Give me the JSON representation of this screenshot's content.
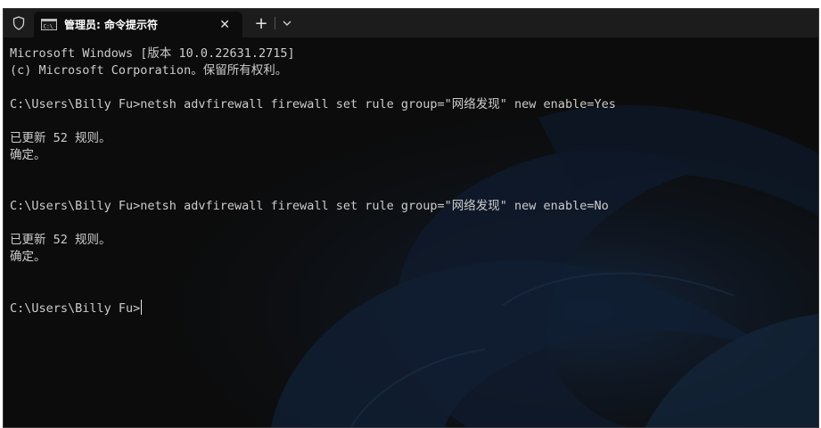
{
  "titlebar": {
    "shield_icon": "shield-icon",
    "tab": {
      "icon": "cmd-icon",
      "icon_text": "C:\\",
      "label": "管理员: 命令提示符",
      "close_glyph": "✕"
    },
    "new_tab_glyph": "+",
    "dropdown_icon": "chevron-down-icon"
  },
  "console": {
    "lines": [
      "Microsoft Windows [版本 10.0.22631.2715]",
      "(c) Microsoft Corporation。保留所有权利。",
      "",
      "C:\\Users\\Billy Fu>netsh advfirewall firewall set rule group=\"网络发现\" new enable=Yes",
      "",
      "已更新 52 规则。",
      "确定。",
      "",
      "",
      "C:\\Users\\Billy Fu>netsh advfirewall firewall set rule group=\"网络发现\" new enable=No",
      "",
      "已更新 52 规则。",
      "确定。",
      "",
      "",
      "C:\\Users\\Billy Fu>"
    ]
  },
  "colors": {
    "background": "#0c0c0c",
    "text": "#cccccc",
    "titlebar": "#1c1c1c"
  }
}
